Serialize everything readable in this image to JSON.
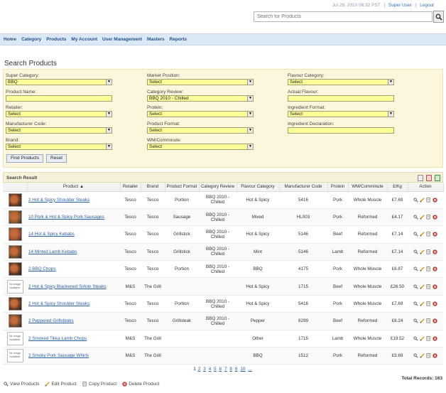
{
  "header": {
    "datetime": "Jul 28, 2010 06:32 PST",
    "user_link": "Super User",
    "logout_link": "Logout",
    "search_placeholder": "Search for Products"
  },
  "nav": [
    "Home",
    "Category",
    "Products",
    "My Account",
    "User Management",
    "Masters",
    "Reports"
  ],
  "page_title": "Search Products",
  "filters": {
    "super_category": {
      "label": "Super Category:",
      "value": "BBQ"
    },
    "product_name": {
      "label": "Product Name:"
    },
    "retailer": {
      "label": "Retailer:",
      "value": "Select"
    },
    "manufacturer_code": {
      "label": "Manufacturer Code:",
      "value": "Select"
    },
    "brand": {
      "label": "Brand:",
      "value": "Select"
    },
    "market_position": {
      "label": "Market Position:",
      "value": "Select"
    },
    "category_review": {
      "label": "Category Review:",
      "value": "BBQ 2010 - Chilled"
    },
    "protein": {
      "label": "Protein:",
      "value": "Select"
    },
    "product_format": {
      "label": "Product Format:",
      "value": "Select"
    },
    "wm_comminute": {
      "label": "WM/Comminute:",
      "value": "Select"
    },
    "flavour_category": {
      "label": "Flavour Category:",
      "value": "Select"
    },
    "actual_flavour": {
      "label": "Actual Flavour:"
    },
    "ingredient_format": {
      "label": "Ingredient Format:",
      "value": "Select"
    },
    "ingredient_declaration": {
      "label": "Ingredient Declaration:"
    },
    "find_button": "Find Products",
    "reset_button": "Reset"
  },
  "results": {
    "title": "Search Result",
    "columns": [
      "",
      "Product ▲",
      "Retailer",
      "Brand",
      "Product Format",
      "Category Review",
      "Flavour Category",
      "Manufacturer Code",
      "Protein",
      "WM/Comminute",
      "£/Kg",
      "Action"
    ],
    "rows": [
      {
        "img": "photo",
        "product": "2 Hot & Spicy Shoulder Steaks",
        "retailer": "Tesco",
        "brand": "Tesco",
        "format": "Portion",
        "review": "BBQ 2010 - Chilled",
        "flavour": "Hot & Spicy",
        "code": "5416",
        "protein": "Pork",
        "wm": "Whole Muscle",
        "price": "£7.69"
      },
      {
        "img": "photo",
        "product": "10 Pork & Hot & Spicy Pork Sausages",
        "retailer": "Tesco",
        "brand": "Tesco",
        "format": "Sausage",
        "review": "BBQ 2010 - Chilled",
        "flavour": "Mixed",
        "code": "HL003",
        "protein": "Pork",
        "wm": "Reformed",
        "price": "£4.17"
      },
      {
        "img": "photo",
        "product": "14 Hot & Spicy Kebabs",
        "retailer": "Tesco",
        "brand": "Tesco",
        "format": "Grillstick",
        "review": "BBQ 2010 - Chilled",
        "flavour": "Hot & Spicy",
        "code": "5146",
        "protein": "Beef",
        "wm": "Reformed",
        "price": "£7.14"
      },
      {
        "img": "photo",
        "product": "14 Minted Lamb Kebabs",
        "retailer": "Tesco",
        "brand": "Tesco",
        "format": "Grillstick",
        "review": "BBQ 2010 - Chilled",
        "flavour": "Mint",
        "code": "5146",
        "protein": "Lamb",
        "wm": "Reformed",
        "price": "£7.14"
      },
      {
        "img": "photo",
        "product": "2 BBQ Chops",
        "retailer": "Tesco",
        "brand": "Tesco",
        "format": "Portion",
        "review": "BBQ 2010 - Chilled",
        "flavour": "BBQ",
        "code": "4175",
        "protein": "Pork",
        "wm": "Whole Muscle",
        "price": "£6.87"
      },
      {
        "img": "none",
        "product": "2 Hot & Spicy Blackened Sirloin Steaks",
        "retailer": "M&S",
        "brand": "The Grill",
        "format": "",
        "review": "",
        "flavour": "Hot & Spicy",
        "code": "1715",
        "protein": "Beef",
        "wm": "Whole Muscle",
        "price": "£26.50"
      },
      {
        "img": "photo",
        "product": "2 Hot & Spicy Shoulder Steaks",
        "retailer": "Tesco",
        "brand": "Tesco",
        "format": "Portion",
        "review": "BBQ 2010 - Chilled",
        "flavour": "Hot & Spicy",
        "code": "5416",
        "protein": "Pork",
        "wm": "Whole Muscle",
        "price": "£7.69"
      },
      {
        "img": "photo",
        "product": "2 Peppered Grillsteaks",
        "retailer": "Tesco",
        "brand": "Tesco",
        "format": "Grillsteak",
        "review": "BBQ 2010 - Chilled",
        "flavour": "Pepper",
        "code": "8299",
        "protein": "Beef",
        "wm": "Reformed",
        "price": "£6.24"
      },
      {
        "img": "none",
        "product": "2 Smoked Tikka Lamb Chops",
        "retailer": "M&S",
        "brand": "The Grill",
        "format": "",
        "review": "",
        "flavour": "Other",
        "code": "1715",
        "protein": "Lamb",
        "wm": "Whole Muscle",
        "price": "£19.52"
      },
      {
        "img": "none",
        "product": "2 Smoky Pork Sausage Whirls",
        "retailer": "M&S",
        "brand": "The Grill",
        "format": "",
        "review": "",
        "flavour": "BBQ",
        "code": "1512",
        "protein": "Pork",
        "wm": "Reformed",
        "price": "£9.69"
      }
    ],
    "no_image_text": "No image available"
  },
  "pagination": {
    "current": "1",
    "pages": [
      "2",
      "3",
      "4",
      "5",
      "6",
      "7",
      "8",
      "9",
      "10",
      "..."
    ]
  },
  "total_records": "Total Records: 163",
  "legend": {
    "view": "View Products",
    "edit": "Edit Product",
    "copy": "Copy Product",
    "delete": "Delete Product"
  },
  "colors": {
    "field_bg": "#ffff99",
    "panel_bg": "#fcf7dc",
    "nav_bg": "#dbe9f7",
    "link": "#2a5faa",
    "delete": "#c0392b"
  }
}
